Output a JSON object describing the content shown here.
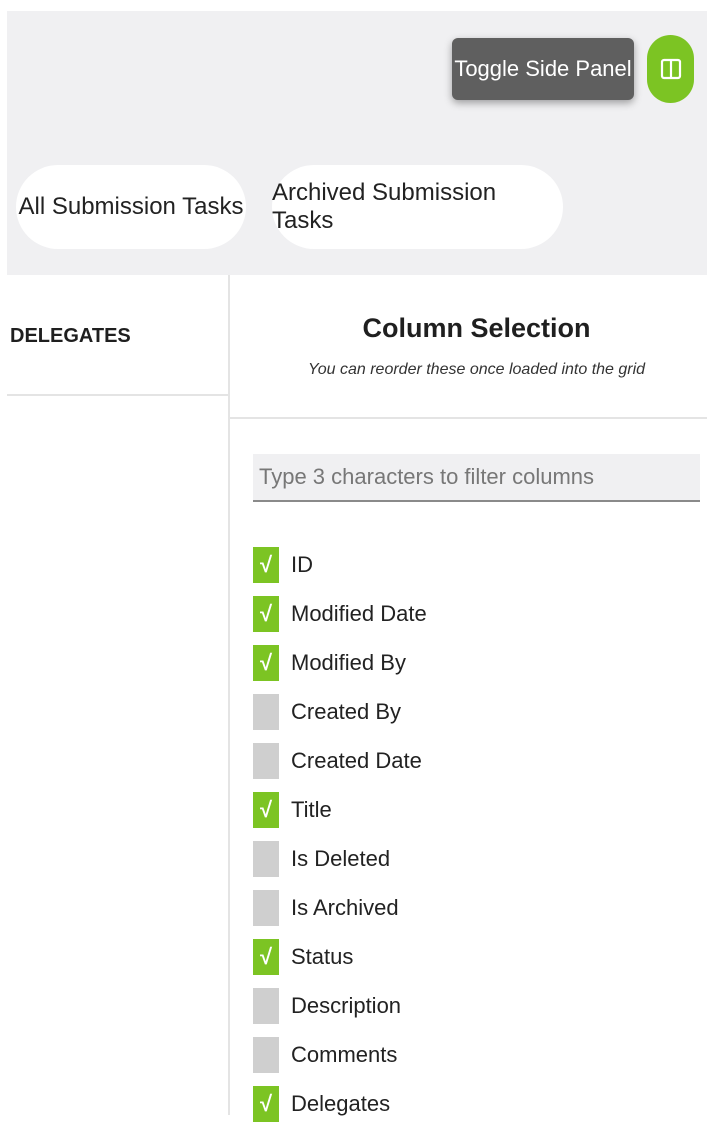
{
  "header": {
    "tooltip": "Toggle Side Panel",
    "toggle_icon": "side-panel-icon",
    "accent_color": "#7cc423"
  },
  "tabs": [
    {
      "label": "All Submission Tasks"
    },
    {
      "label": "Archived Submission Tasks"
    }
  ],
  "side_panel": {
    "header": "DELEGATES"
  },
  "column_selection": {
    "title": "Column Selection",
    "subtitle": "You can reorder these once loaded into the grid",
    "filter_placeholder": "Type 3 characters to filter columns",
    "filter_value": "",
    "columns": [
      {
        "label": "ID",
        "checked": true
      },
      {
        "label": "Modified Date",
        "checked": true
      },
      {
        "label": "Modified By",
        "checked": true
      },
      {
        "label": "Created By",
        "checked": false
      },
      {
        "label": "Created Date",
        "checked": false
      },
      {
        "label": "Title",
        "checked": true
      },
      {
        "label": "Is Deleted",
        "checked": false
      },
      {
        "label": "Is Archived",
        "checked": false
      },
      {
        "label": "Status",
        "checked": true
      },
      {
        "label": "Description",
        "checked": false
      },
      {
        "label": "Comments",
        "checked": false
      },
      {
        "label": "Delegates",
        "checked": true
      }
    ],
    "check_glyph": "√"
  }
}
